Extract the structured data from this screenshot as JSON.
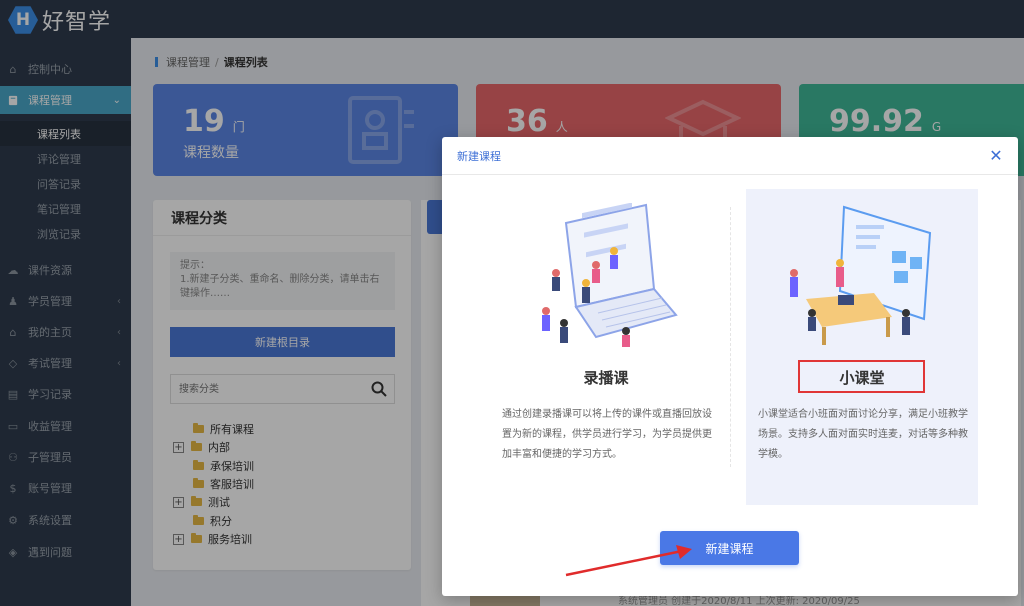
{
  "app": {
    "logo_letter": "H",
    "logo_text": "好智学"
  },
  "sidebar": {
    "items": [
      {
        "label": "控制中心",
        "icon": "home-icon"
      },
      {
        "label": "课程管理",
        "icon": "book-icon",
        "active": true
      },
      {
        "label": "课件资源",
        "icon": "cloud-icon"
      },
      {
        "label": "学员管理",
        "icon": "graduate-icon"
      },
      {
        "label": "我的主页",
        "icon": "graduation-cap-icon"
      },
      {
        "label": "考试管理",
        "icon": "shield-icon"
      },
      {
        "label": "学习记录",
        "icon": "chart-icon"
      },
      {
        "label": "收益管理",
        "icon": "wallet-icon"
      },
      {
        "label": "子管理员",
        "icon": "user-icon"
      },
      {
        "label": "账号管理",
        "icon": "dollar-icon"
      },
      {
        "label": "系统设置",
        "icon": "gear-icon"
      },
      {
        "label": "遇到问题",
        "icon": "tag-icon"
      }
    ],
    "sub_items": [
      "课程列表",
      "评论管理",
      "问答记录",
      "笔记管理",
      "浏览记录"
    ]
  },
  "breadcrumb": {
    "parent": "课程管理",
    "separator": "/",
    "current": "课程列表"
  },
  "stats": [
    {
      "value": "19",
      "unit": "门",
      "label": "课程数量",
      "color": "#5b86e5"
    },
    {
      "value": "36",
      "unit": "人",
      "label": "",
      "color": "#e8676b"
    },
    {
      "value": "99.92",
      "unit": "G",
      "label": "",
      "color": "#3fb899"
    }
  ],
  "category": {
    "title": "课程分类",
    "tip": "提示：\n1.新建子分类、重命名、删除分类，请单击右键操作……",
    "new_root_label": "新建根目录",
    "search_placeholder": "搜索分类",
    "tree": [
      {
        "label": "所有课程",
        "expandable": false
      },
      {
        "label": "内部",
        "expandable": true
      },
      {
        "label": "承保培训",
        "expandable": false
      },
      {
        "label": "客服培训",
        "expandable": false
      },
      {
        "label": "测试",
        "expandable": true
      },
      {
        "label": "积分",
        "expandable": false
      },
      {
        "label": "服务培训",
        "expandable": true
      }
    ]
  },
  "background_footer": "系统管理员 创建于2020/8/11 上次更新: 2020/09/25",
  "modal": {
    "title": "新建课程",
    "options": [
      {
        "title": "录播课",
        "desc": "通过创建录播课可以将上传的课件或直播回放设置为新的课程，供学员进行学习，为学员提供更加丰富和便捷的学习方式。"
      },
      {
        "title": "小课堂",
        "desc": "小课堂适合小班面对面讨论分享，满足小班教学场景。支持多人面对面实时连麦，对话等多种教学模。"
      }
    ],
    "create_label": "新建课程"
  }
}
